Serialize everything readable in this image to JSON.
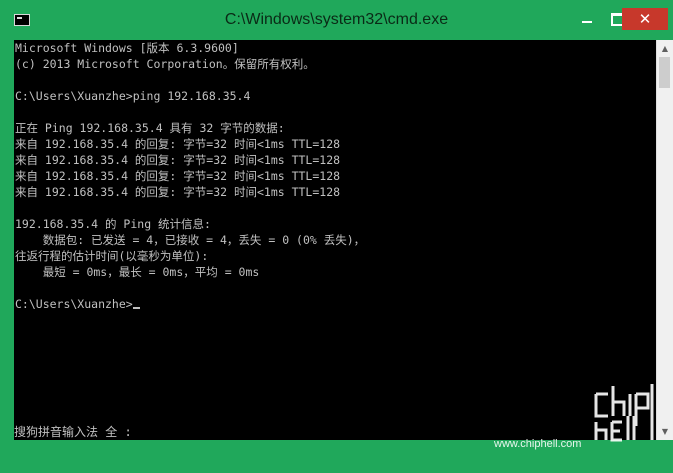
{
  "window": {
    "title": "C:\\Windows\\system32\\cmd.exe",
    "close_glyph": "✕"
  },
  "console": {
    "lines": [
      "Microsoft Windows [版本 6.3.9600]",
      "(c) 2013 Microsoft Corporation。保留所有权利。",
      "",
      "C:\\Users\\Xuanzhe>ping 192.168.35.4",
      "",
      "正在 Ping 192.168.35.4 具有 32 字节的数据:",
      "来自 192.168.35.4 的回复: 字节=32 时间<1ms TTL=128",
      "来自 192.168.35.4 的回复: 字节=32 时间<1ms TTL=128",
      "来自 192.168.35.4 的回复: 字节=32 时间<1ms TTL=128",
      "来自 192.168.35.4 的回复: 字节=32 时间<1ms TTL=128",
      "",
      "192.168.35.4 的 Ping 统计信息:",
      "    数据包: 已发送 = 4，已接收 = 4，丢失 = 0 (0% 丢失)，",
      "往返行程的估计时间(以毫秒为单位):",
      "    最短 = 0ms，最长 = 0ms，平均 = 0ms",
      "",
      "C:\\Users\\Xuanzhe>"
    ],
    "ime_status": "搜狗拼音输入法 全 :"
  },
  "watermark": {
    "logo_text": "chiphell",
    "url": "www.chiphell.com"
  }
}
